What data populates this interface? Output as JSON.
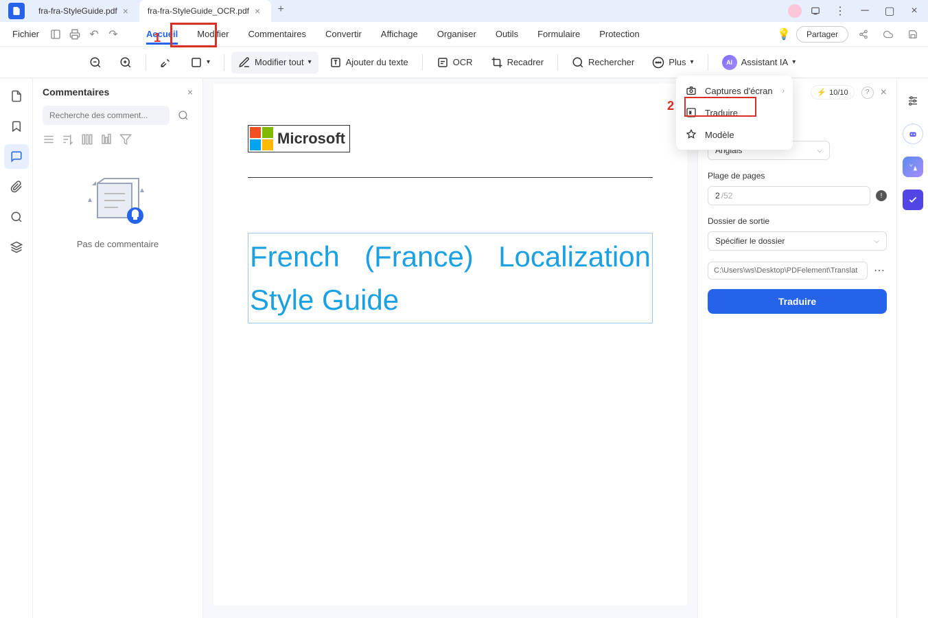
{
  "tabs": [
    {
      "label": "fra-fra-StyleGuide.pdf"
    },
    {
      "label": "fra-fra-StyleGuide_OCR.pdf"
    }
  ],
  "file_menu": "Fichier",
  "menu": {
    "accueil": "Accueil",
    "modifier": "Modifier",
    "commentaires": "Commentaires",
    "convertir": "Convertir",
    "affichage": "Affichage",
    "organiser": "Organiser",
    "outils": "Outils",
    "formulaire": "Formulaire",
    "protection": "Protection"
  },
  "share": "Partager",
  "toolbar": {
    "modify_all": "Modifier tout",
    "add_text": "Ajouter du texte",
    "ocr": "OCR",
    "crop": "Recadrer",
    "search": "Rechercher",
    "plus": "Plus",
    "assistant": "Assistant IA"
  },
  "dropdown": {
    "screenshot": "Captures d'écran",
    "translate": "Traduire",
    "template": "Modèle"
  },
  "comments": {
    "title": "Commentaires",
    "search_ph": "Recherche des comment...",
    "empty": "Pas de commentaire"
  },
  "document": {
    "brand": "Microsoft",
    "title": "French (France) Localization Style Guide"
  },
  "ai": {
    "tokens": "10/10",
    "language": "Anglais",
    "range_label": "Plage de pages",
    "page_current": "2",
    "page_total": "/52",
    "output_label": "Dossier de sortie",
    "folder_ph": "Spécifier le dossier",
    "path": "C:\\Users\\ws\\Desktop\\PDFelement\\Translat",
    "translate_btn": "Traduire"
  },
  "annotations": {
    "step1": "1",
    "step2": "2"
  }
}
